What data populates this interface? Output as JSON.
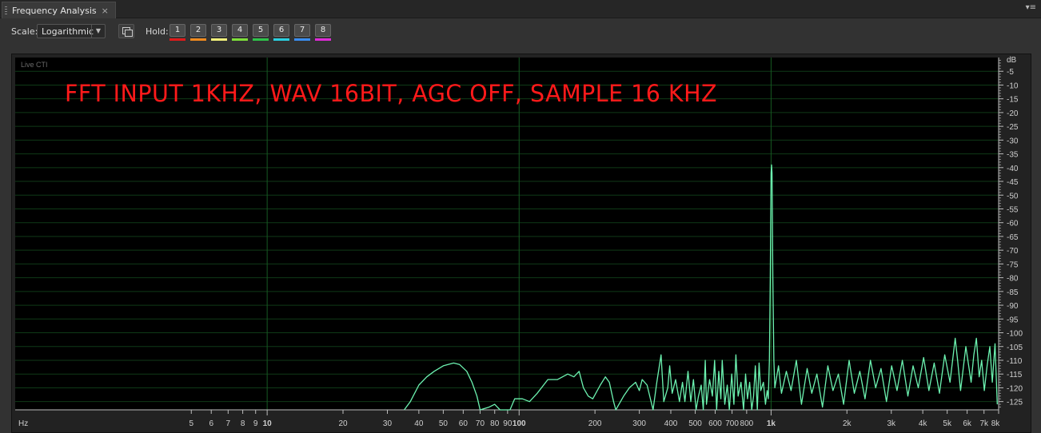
{
  "panel": {
    "tab_title": "Frequency Analysis",
    "close_glyph": "×",
    "menu_glyph": "▾≡"
  },
  "toolbar": {
    "scale_label": "Scale:",
    "scale_value": "Logarithmic",
    "hold_label": "Hold:",
    "hold_buttons": [
      {
        "label": "1",
        "color": "#e01a1a"
      },
      {
        "label": "2",
        "color": "#f08a1e"
      },
      {
        "label": "3",
        "color": "#f2f07a"
      },
      {
        "label": "4",
        "color": "#7ee03a"
      },
      {
        "label": "5",
        "color": "#2ec44a"
      },
      {
        "label": "6",
        "color": "#2ad0e0"
      },
      {
        "label": "7",
        "color": "#3a8ef0"
      },
      {
        "label": "8",
        "color": "#e02ad8"
      }
    ]
  },
  "plot": {
    "live_label": "Live CTI",
    "annotation": "FFT INPUT 1KHZ, WAV 16BIT, AGC OFF, SAMPLE 16 KHZ",
    "annotation_color": "#ff1a1a",
    "trace_color": "#6cf2b0",
    "db_unit": "dB",
    "hz_unit": "Hz"
  },
  "chart_data": {
    "type": "line",
    "x_scale": "log",
    "xlim": [
      1,
      8000
    ],
    "ylim": [
      -128,
      0
    ],
    "x_ticks": [
      {
        "v": 5,
        "t": "5"
      },
      {
        "v": 6,
        "t": "6"
      },
      {
        "v": 7,
        "t": "7"
      },
      {
        "v": 8,
        "t": "8"
      },
      {
        "v": 9,
        "t": "9"
      },
      {
        "v": 10,
        "t": "10",
        "major": true
      },
      {
        "v": 20,
        "t": "20"
      },
      {
        "v": 30,
        "t": "30"
      },
      {
        "v": 40,
        "t": "40"
      },
      {
        "v": 50,
        "t": "50"
      },
      {
        "v": 60,
        "t": "60"
      },
      {
        "v": 70,
        "t": "70"
      },
      {
        "v": 80,
        "t": "80"
      },
      {
        "v": 90,
        "t": "90"
      },
      {
        "v": 100,
        "t": "100",
        "major": true
      },
      {
        "v": 200,
        "t": "200"
      },
      {
        "v": 300,
        "t": "300"
      },
      {
        "v": 400,
        "t": "400"
      },
      {
        "v": 500,
        "t": "500"
      },
      {
        "v": 600,
        "t": "600"
      },
      {
        "v": 700,
        "t": "700"
      },
      {
        "v": 800,
        "t": "800"
      },
      {
        "v": 1000,
        "t": "1k",
        "major": true
      },
      {
        "v": 2000,
        "t": "2k"
      },
      {
        "v": 3000,
        "t": "3k"
      },
      {
        "v": 4000,
        "t": "4k"
      },
      {
        "v": 5000,
        "t": "5k"
      },
      {
        "v": 6000,
        "t": "6k"
      },
      {
        "v": 7000,
        "t": "7k"
      },
      {
        "v": 8000,
        "t": "8k"
      }
    ],
    "y_ticks": [
      -5,
      -10,
      -15,
      -20,
      -25,
      -30,
      -35,
      -40,
      -45,
      -50,
      -55,
      -60,
      -65,
      -70,
      -75,
      -80,
      -85,
      -90,
      -95,
      -100,
      -105,
      -110,
      -115,
      -120,
      -125
    ],
    "series": [
      {
        "points": [
          [
            35,
            -128
          ],
          [
            37,
            -125
          ],
          [
            40,
            -119
          ],
          [
            43,
            -116
          ],
          [
            46,
            -114
          ],
          [
            50,
            -112
          ],
          [
            55,
            -111
          ],
          [
            58,
            -111.5
          ],
          [
            62,
            -114
          ],
          [
            65,
            -118
          ],
          [
            68,
            -123
          ],
          [
            70,
            -128
          ],
          [
            76,
            -127
          ],
          [
            80,
            -126
          ],
          [
            84,
            -128
          ],
          [
            92,
            -128
          ],
          [
            96,
            -124
          ],
          [
            103,
            -124
          ],
          [
            110,
            -125
          ],
          [
            118,
            -122
          ],
          [
            130,
            -117
          ],
          [
            142,
            -117
          ],
          [
            156,
            -115
          ],
          [
            165,
            -116
          ],
          [
            173,
            -114
          ],
          [
            180,
            -120
          ],
          [
            188,
            -123
          ],
          [
            196,
            -124
          ],
          [
            210,
            -119
          ],
          [
            220,
            -116
          ],
          [
            228,
            -118
          ],
          [
            237,
            -125
          ],
          [
            242,
            -128
          ],
          [
            260,
            -123
          ],
          [
            274,
            -120
          ],
          [
            290,
            -118
          ],
          [
            300,
            -121
          ],
          [
            308,
            -117
          ],
          [
            322,
            -119
          ],
          [
            340,
            -128
          ],
          [
            352,
            -118
          ],
          [
            366,
            -108
          ],
          [
            375,
            -125
          ],
          [
            389,
            -120
          ],
          [
            396,
            -112
          ],
          [
            405,
            -122
          ],
          [
            418,
            -117
          ],
          [
            433,
            -125
          ],
          [
            445,
            -118
          ],
          [
            455,
            -125
          ],
          [
            468,
            -114
          ],
          [
            480,
            -125
          ],
          [
            492,
            -117
          ],
          [
            504,
            -128
          ],
          [
            515,
            -123
          ],
          [
            528,
            -119
          ],
          [
            538,
            -128
          ],
          [
            548,
            -110
          ],
          [
            554,
            -126
          ],
          [
            570,
            -117
          ],
          [
            585,
            -123
          ],
          [
            597,
            -110
          ],
          [
            608,
            -128
          ],
          [
            620,
            -114
          ],
          [
            632,
            -124
          ],
          [
            640,
            -110
          ],
          [
            655,
            -126
          ],
          [
            670,
            -119
          ],
          [
            683,
            -128
          ],
          [
            698,
            -115
          ],
          [
            712,
            -126
          ],
          [
            725,
            -108
          ],
          [
            740,
            -123
          ],
          [
            760,
            -118
          ],
          [
            778,
            -128
          ],
          [
            792,
            -115
          ],
          [
            806,
            -124
          ],
          [
            822,
            -118
          ],
          [
            838,
            -128
          ],
          [
            852,
            -123
          ],
          [
            866,
            -112
          ],
          [
            882,
            -128
          ],
          [
            896,
            -111
          ],
          [
            910,
            -121
          ],
          [
            932,
            -118
          ],
          [
            950,
            -126
          ],
          [
            965,
            -121
          ],
          [
            975,
            -124
          ],
          [
            985,
            -110
          ],
          [
            993,
            -80
          ],
          [
            1000,
            -42
          ],
          [
            1004,
            -39
          ],
          [
            1009,
            -42
          ],
          [
            1016,
            -80
          ],
          [
            1026,
            -110
          ],
          [
            1035,
            -120
          ],
          [
            1070,
            -112
          ],
          [
            1100,
            -122
          ],
          [
            1150,
            -114
          ],
          [
            1200,
            -121
          ],
          [
            1260,
            -110
          ],
          [
            1320,
            -126
          ],
          [
            1390,
            -113
          ],
          [
            1450,
            -122
          ],
          [
            1520,
            -115
          ],
          [
            1600,
            -127
          ],
          [
            1680,
            -112
          ],
          [
            1760,
            -121
          ],
          [
            1850,
            -115
          ],
          [
            1940,
            -126
          ],
          [
            2040,
            -110
          ],
          [
            2140,
            -122
          ],
          [
            2250,
            -114
          ],
          [
            2360,
            -124
          ],
          [
            2480,
            -110
          ],
          [
            2600,
            -120
          ],
          [
            2730,
            -113
          ],
          [
            2870,
            -125
          ],
          [
            3010,
            -112
          ],
          [
            3160,
            -121
          ],
          [
            3320,
            -110
          ],
          [
            3490,
            -123
          ],
          [
            3660,
            -112
          ],
          [
            3840,
            -120
          ],
          [
            4030,
            -109
          ],
          [
            4230,
            -121
          ],
          [
            4440,
            -111
          ],
          [
            4660,
            -122
          ],
          [
            4890,
            -108
          ],
          [
            5130,
            -118
          ],
          [
            5380,
            -102
          ],
          [
            5500,
            -110
          ],
          [
            5650,
            -121
          ],
          [
            5930,
            -105
          ],
          [
            6220,
            -118
          ],
          [
            6380,
            -108
          ],
          [
            6530,
            -102
          ],
          [
            6700,
            -116
          ],
          [
            6850,
            -110
          ],
          [
            7020,
            -121
          ],
          [
            7200,
            -112
          ],
          [
            7380,
            -105
          ],
          [
            7550,
            -118
          ],
          [
            7740,
            -104
          ],
          [
            7900,
            -126
          ]
        ]
      }
    ]
  }
}
